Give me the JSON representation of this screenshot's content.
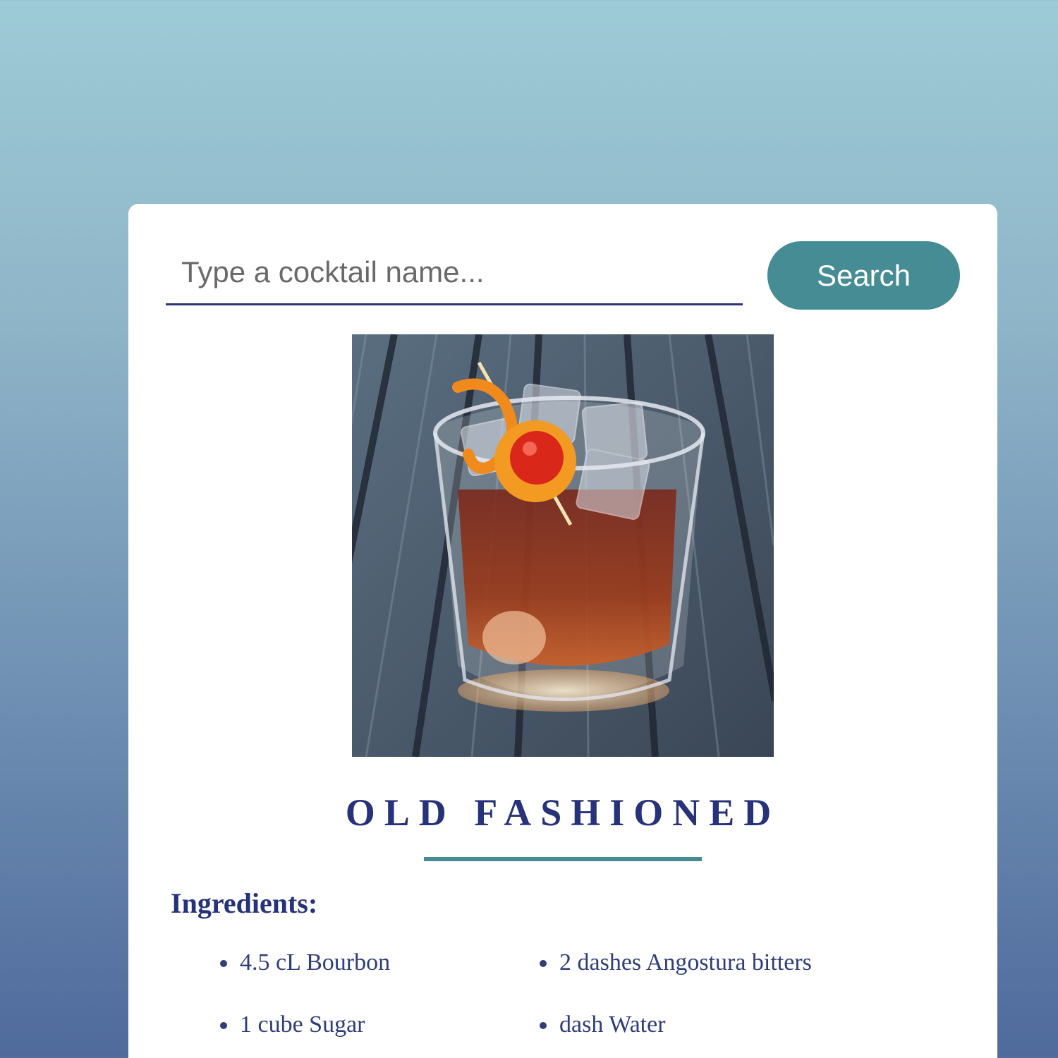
{
  "search": {
    "placeholder": "Type a cocktail name...",
    "button_label": "Search"
  },
  "drink": {
    "name": "OLD FASHIONED",
    "image_alt": "Old Fashioned cocktail in a rocks glass on a wooden table",
    "ingredients_heading": "Ingredients:",
    "ingredients": [
      "4.5 cL Bourbon",
      "2 dashes Angostura bitters",
      "1 cube Sugar",
      "dash Water"
    ]
  },
  "colors": {
    "accent": "#458c94",
    "title": "#26337a",
    "text": "#2f3e7a"
  }
}
